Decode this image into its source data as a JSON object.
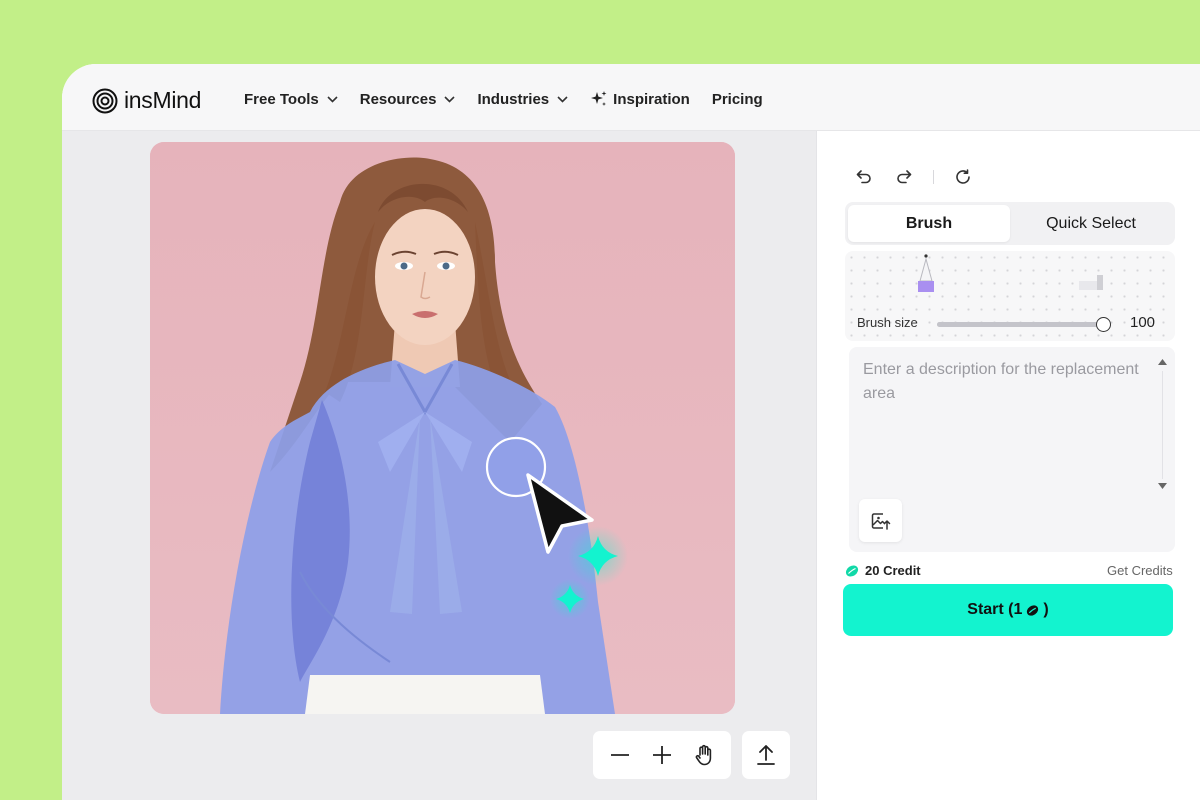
{
  "brand": {
    "name": "insMind"
  },
  "nav": {
    "items": [
      {
        "label": "Free Tools",
        "dropdown": true
      },
      {
        "label": "Resources",
        "dropdown": true
      },
      {
        "label": "Industries",
        "dropdown": true
      },
      {
        "label": "Inspiration",
        "dropdown": false,
        "icon": "sparkle-icon"
      },
      {
        "label": "Pricing",
        "dropdown": false
      }
    ]
  },
  "editor": {
    "tabs": [
      {
        "label": "Brush",
        "active": true
      },
      {
        "label": "Quick Select",
        "active": false
      }
    ],
    "brush": {
      "label": "Brush size",
      "value": "100",
      "level": 1.0
    },
    "prompt": {
      "placeholder": "Enter a description for the replacement area"
    },
    "credits": {
      "amount": "20 Credit",
      "get_label": "Get Credits"
    },
    "start": {
      "label": "Start (1",
      "close": ")"
    }
  },
  "colors": {
    "page_background": "#c2ef88",
    "accent": "#13f3cf",
    "mask_overlay": "#8c9ee6",
    "photo_background": "#e9b9c0"
  }
}
